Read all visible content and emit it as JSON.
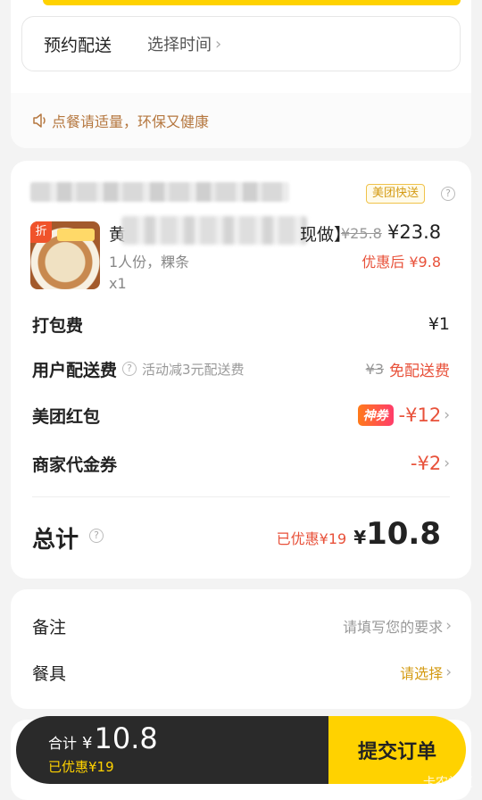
{
  "schedule": {
    "label": "预约配送",
    "value": "选择时间"
  },
  "notice": {
    "text": "点餐请适量，环保又健康"
  },
  "order": {
    "delivery_badge": "美团快送",
    "product": {
      "badge": "折",
      "name_head": "黄",
      "name_tail": "现做】",
      "original_price": "¥25.8",
      "price": "¥23.8",
      "spec": "1人份，粿条",
      "discounted_price": "优惠后 ¥9.8",
      "quantity": "x1"
    },
    "packing_fee": {
      "label": "打包费",
      "value": "¥1"
    },
    "delivery_fee": {
      "label": "用户配送费",
      "note": "活动减3元配送费",
      "original": "¥3",
      "value": "免配送费"
    },
    "red_packet": {
      "label": "美团红包",
      "tag": "神券",
      "value": "-¥12"
    },
    "voucher": {
      "label": "商家代金券",
      "value": "-¥2"
    },
    "total": {
      "label": "总计",
      "saved": "已优惠¥19",
      "currency": "¥",
      "amount": "10.8"
    }
  },
  "remarks": {
    "note": {
      "label": "备注",
      "placeholder": "请填写您的要求"
    },
    "utensils": {
      "label": "餐具",
      "value": "请选择"
    }
  },
  "bottom_bar": {
    "sum_label": "合计",
    "currency": "¥",
    "amount": "10.8",
    "saved": "已优惠¥19",
    "submit_label": "提交订单"
  },
  "watermark": "卡农社区",
  "colors": {
    "accent": "#ffd200",
    "discount_red": "#e8513a",
    "dark_bar": "#2a2a2a"
  }
}
